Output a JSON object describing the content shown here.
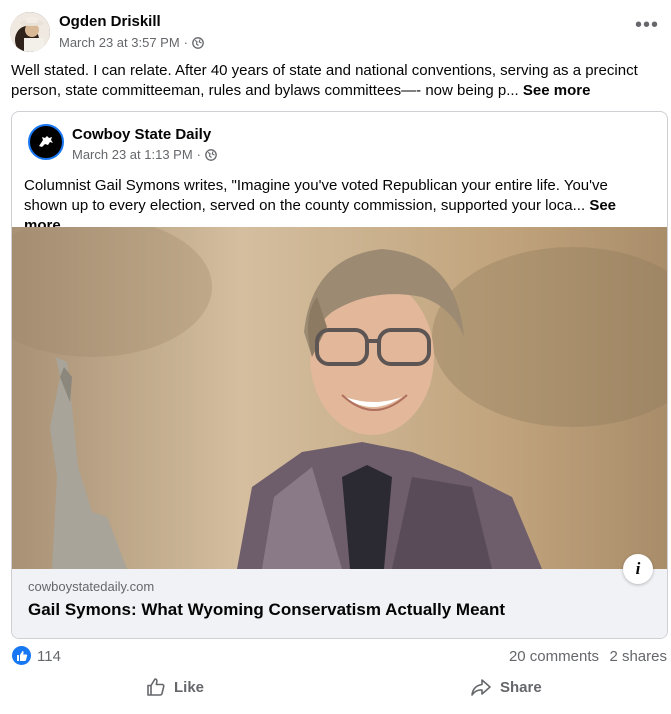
{
  "post": {
    "author": "Ogden Driskill",
    "timestamp": "March 23 at 3:57 PM",
    "separator": "·",
    "text": "Well stated. I can relate. After 40 years of state and national conventions, serving as a precinct person, state committeeman, rules and bylaws committees—- now being p... ",
    "see_more": "See more",
    "more_icon": "•••"
  },
  "shared": {
    "page_name": "Cowboy State Daily",
    "timestamp": "March 23 at 1:13 PM",
    "separator": "·",
    "text": "Columnist Gail Symons writes, \"Imagine you've voted Republican your entire life. You've shown up to every election, served on the county commission, supported your loca... ",
    "see_more": "See more",
    "link_domain": "cowboystatedaily.com",
    "link_title": "Gail Symons: What Wyoming Conservatism Actually Meant",
    "info_icon": "i"
  },
  "stats": {
    "likes": "114",
    "comments": "20 comments",
    "shares": "2 shares"
  },
  "actions": {
    "like": "Like",
    "share": "Share"
  },
  "colors": {
    "accent": "#1877f2",
    "secondary_text": "#65676b",
    "link_bar_bg": "#f0f2f5"
  }
}
